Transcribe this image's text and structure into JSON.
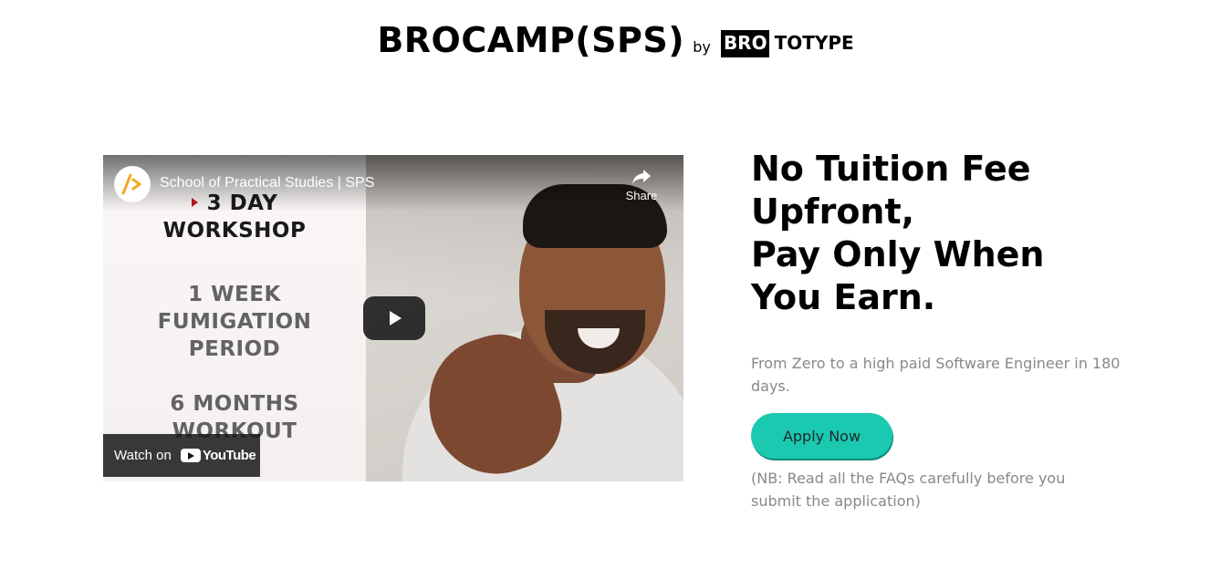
{
  "header": {
    "title": "BROCAMP(SPS)",
    "by": "by",
    "logo_box_text": "BRO",
    "logo_rest_text": "TOTYPE"
  },
  "video": {
    "title": "School of Practical Studies | SPS",
    "share_label": "Share",
    "watch_on_label": "Watch on",
    "youtube_label": "YouTube",
    "thumbnail_lines": {
      "line1": "3 DAY",
      "line2": "WORKSHOP",
      "line3": "1 WEEK",
      "line4": "FUMIGATION",
      "line5": "PERIOD",
      "line6": "6 MONTHS",
      "line7": "WORKOUT"
    },
    "icons": [
      "channel-logo-icon",
      "share-icon",
      "play-icon",
      "youtube-logo-icon"
    ]
  },
  "hero": {
    "heading_line1": "No Tuition Fee",
    "heading_line2": "Upfront,",
    "heading_line3": "Pay Only When",
    "heading_line4": "You Earn.",
    "subtitle": "From Zero to a high paid Software Engineer in 180 days.",
    "apply_label": "Apply Now",
    "note": "(NB: Read all the FAQs carefully before you submit the application)"
  },
  "colors": {
    "accent": "#1ac9b0",
    "muted_text": "#888888",
    "logo_arrow": "#f5a623"
  }
}
